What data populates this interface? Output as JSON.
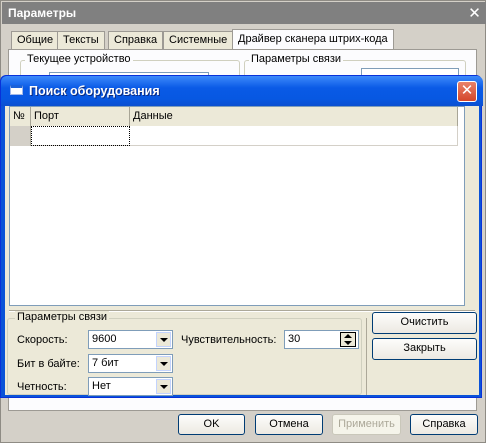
{
  "outer_dialog": {
    "title": "Параметры",
    "tabs": [
      {
        "label": "Общие"
      },
      {
        "label": "Тексты"
      },
      {
        "label": "Справка"
      },
      {
        "label": "Системные"
      },
      {
        "label": "Драйвер сканера штрих-кода"
      }
    ],
    "active_tab": "Драйвер сканера штрих-кода",
    "groups": {
      "current_device": "Текущее устройство",
      "connection_params": "Параметры связи"
    },
    "buttons": {
      "ok": "OK",
      "cancel": "Отмена",
      "apply": "Применить",
      "help": "Справка"
    }
  },
  "search_dialog": {
    "title": "Поиск оборудования",
    "grid": {
      "columns": [
        "№",
        "Порт",
        "Данные"
      ],
      "rows": [
        {
          "num": "",
          "port": "",
          "data": ""
        }
      ]
    },
    "connection": {
      "group_title": "Параметры связи",
      "speed": {
        "label": "Скорость:",
        "value": "9600"
      },
      "bits": {
        "label": "Бит в байте:",
        "value": "7 бит"
      },
      "parity": {
        "label": "Четность:",
        "value": "Нет"
      },
      "sensitivity": {
        "label": "Чувствительность:",
        "value": "30"
      }
    },
    "buttons": {
      "clear": "Очистить",
      "close": "Закрыть"
    }
  },
  "colors": {
    "xp_title_blue": "#0a5ae6",
    "close_red": "#d5462a",
    "dialog_face": "#ece9d8"
  }
}
